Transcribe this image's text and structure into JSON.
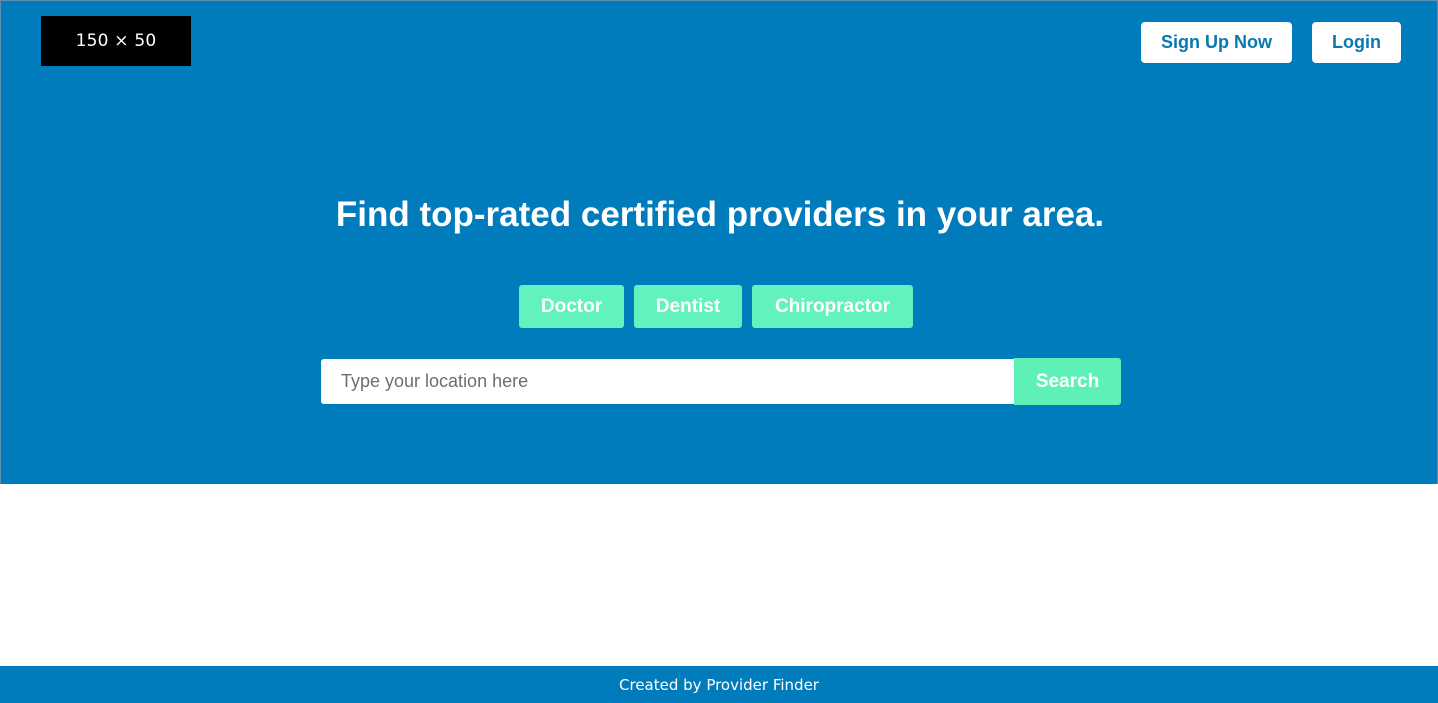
{
  "header": {
    "logo_text": "150 × 50",
    "signup_label": "Sign Up Now",
    "login_label": "Login"
  },
  "hero": {
    "headline": "Find top-rated certified providers in your area.",
    "categories": [
      "Doctor",
      "Dentist",
      "Chiropractor"
    ]
  },
  "search": {
    "placeholder": "Type your location here",
    "value": "",
    "button_label": "Search"
  },
  "footer": {
    "text": "Created by Provider Finder"
  },
  "colors": {
    "brand_blue": "#007bbc",
    "accent_green": "#62f2bd",
    "white": "#ffffff"
  }
}
